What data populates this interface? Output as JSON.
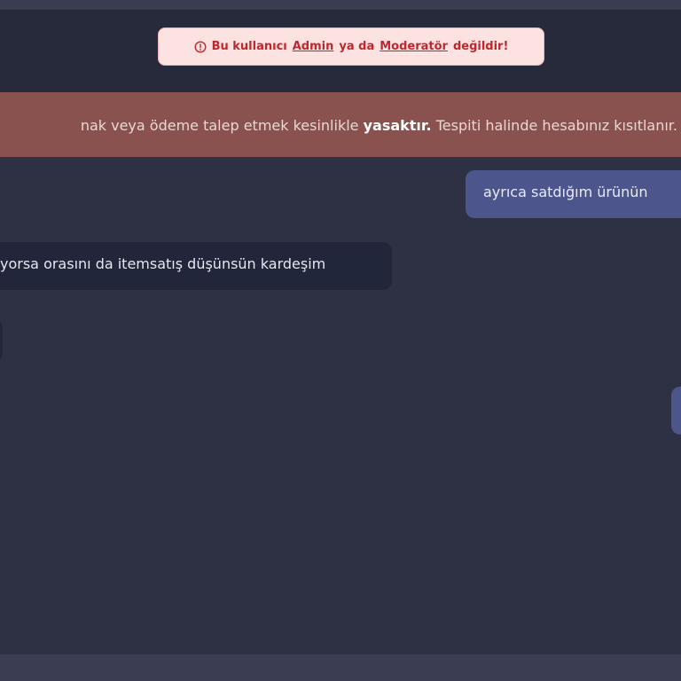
{
  "alert": {
    "icon": "alert-circle-icon",
    "prefix": "Bu kullanıcı",
    "link_admin": "Admin",
    "middle": "ya da",
    "link_moderator": "Moderatör",
    "suffix": "değildir!"
  },
  "warning": {
    "text_before": "nak veya ödeme talep etmek kesinlikle",
    "text_bold": "yasaktır.",
    "text_after": "Tespiti halinde hesabınız kısıtlanır."
  },
  "messages": [
    {
      "direction": "outgoing",
      "text": "ayrıca satdığım ürünün"
    },
    {
      "direction": "incoming",
      "text": "yorsa orasını da itemsatış düşünsün kardeşim"
    },
    {
      "direction": "incoming",
      "text": ""
    },
    {
      "direction": "outgoing",
      "text": ""
    }
  ],
  "colors": {
    "alert_text": "#c0262d",
    "alert_bg": "#fde2e2",
    "warning_bg": "#8a524f",
    "outgoing_bubble": "#4c558c",
    "incoming_bubble": "#22263a",
    "chat_bg": "#2e3143"
  }
}
